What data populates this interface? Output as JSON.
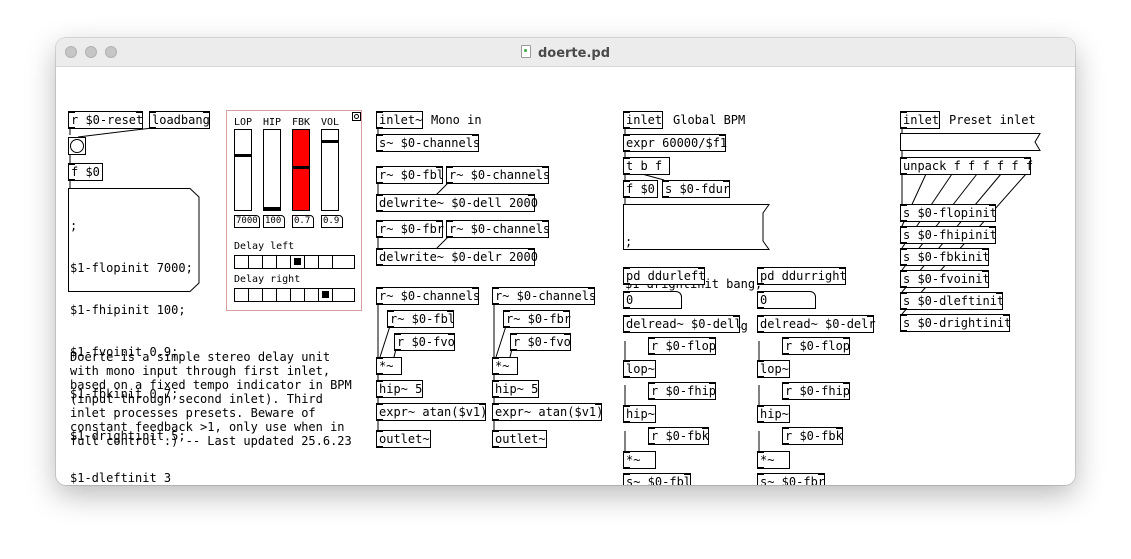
{
  "window": {
    "title": "doerte.pd"
  },
  "objects": {
    "reset": "r $0-reset",
    "loadbang": "loadbang",
    "f0": "f $0",
    "inlet_mono": "inlet~",
    "s_channels": "s~ $0-channels",
    "r_fbl": "r~ $0-fbl",
    "r_channels1": "r~ $0-channels",
    "delwrite_l": "delwrite~ $0-dell 2000",
    "r_fbr": "r~ $0-fbr",
    "r_channels2": "r~ $0-channels",
    "delwrite_r": "delwrite~ $0-delr 2000",
    "r_channels_l": "r~ $0-channels",
    "r_fbl_b": "r~ $0-fbl",
    "r_fvo_l": "r $0-fvo",
    "mul_l": "*~",
    "hip5_l": "hip~ 5",
    "atan_l": "expr~ atan($v1)",
    "outlet_l": "outlet~",
    "r_channels_r": "r~ $0-channels",
    "r_fbr_b": "r~ $0-fbr",
    "r_fvo_r": "r $0-fvo",
    "mul_r": "*~",
    "hip5_r": "hip~ 5",
    "atan_r": "expr~ atan($v1)",
    "outlet_r": "outlet~",
    "inlet_bpm": "inlet",
    "expr_bpm": "expr 60000/$f1",
    "tbf": "t b f",
    "f0b": "f $0",
    "s_fdur": "s $0-fdur",
    "pd_left": "pd ddurleft",
    "zero_left": "0",
    "delread_l": "delread~ $0-dell",
    "r_flop_l": "r $0-flop",
    "lop_l": "lop~",
    "r_fhip_l": "r $0-fhip",
    "hip_l": "hip~",
    "r_fbk_l": "r $0-fbk",
    "mul2_l": "*~",
    "s_fbl": "s~ $0-fbl",
    "pd_right": "pd ddurright",
    "zero_right": "0",
    "delread_r": "delread~ $0-delr",
    "r_flop_r": "r $0-flop",
    "lop_r": "lop~",
    "r_fhip_r": "r $0-fhip",
    "hip_r": "hip~",
    "r_fbk_r": "r $0-fbk",
    "mul2_r": "*~",
    "s_fbr": "s~ $0-fbr",
    "inlet_preset": "inlet",
    "preset_msg": "",
    "unpack": "unpack f f f f f f",
    "s_flop": "s $0-flopinit",
    "s_fhip": "s $0-fhipinit",
    "s_fbk": "s $0-fbkinit",
    "s_fvo": "s $0-fvoinit",
    "s_dleft": "s $0-dleftinit",
    "s_dright": "s $0-drightinit"
  },
  "messages": {
    "init_lines": [
      ";",
      "$1-flopinit 7000;",
      "$1-fhipinit 100;",
      "$1-fvoinit 0.9;",
      "$1-fbkinit 0.7;",
      "$1-drightinit 5;",
      "$1-dleftinit 3"
    ],
    "bpm_lines": [
      ";",
      "$1-drightinit bang;",
      "$1-dleftinit bang"
    ]
  },
  "comments": {
    "mono_in": "Mono in",
    "global_bpm": "Global BPM",
    "preset_inlet": "Preset inlet",
    "description": "Doerte is a simple stereo delay unit\nwith mono input through first inlet,\nbased on a fixed tempo indicator in BPM\n(input through second inlet). Third\ninlet processes presets. Beware of\nconstant feedback >1, only use when in\nfull control :) -- Last updated 25.6.23"
  },
  "gui": {
    "sliders": [
      {
        "label": "LOP",
        "value": "7000",
        "level": 0.7,
        "color": "#ffffff"
      },
      {
        "label": "HIP",
        "value": "100",
        "level": 0.02,
        "color": "#ffffff"
      },
      {
        "label": "FBK",
        "value": "0.7",
        "level": 0.55,
        "color": "#ff0000"
      },
      {
        "label": "VOL",
        "value": "0.9",
        "level": 0.88,
        "color": "#ffffff"
      }
    ],
    "delay_left_label": "Delay left",
    "delay_right_label": "Delay right",
    "delay_left_selected": 4,
    "delay_right_selected": 6,
    "radio_cells": 8
  }
}
